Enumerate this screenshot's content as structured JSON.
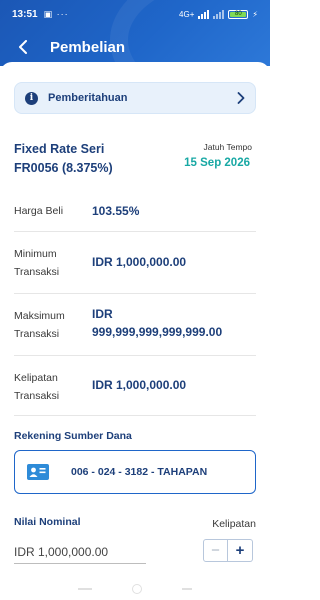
{
  "status_bar": {
    "time": "13:51",
    "left_icons": "▣ ···",
    "network": "4G+",
    "battery": "80"
  },
  "header": {
    "title": "Pembelian",
    "back_icon": "arrow-left-icon"
  },
  "notice": {
    "label": "Pemberitahuan",
    "icon": "info-icon",
    "chevron": "chevron-right-icon"
  },
  "bond": {
    "name_line1": "Fixed Rate Seri",
    "name_line2": "FR0056 (8.375%)",
    "due_label": "Jatuh Tempo",
    "due_date": "15 Sep 2026"
  },
  "details": [
    {
      "label_lines": [
        "Harga Beli"
      ],
      "value_lines": [
        "103.55%"
      ]
    },
    {
      "label_lines": [
        "Minimum",
        "Transaksi"
      ],
      "value_lines": [
        "IDR 1,000,000.00"
      ]
    },
    {
      "label_lines": [
        "Maksimum",
        "Transaksi"
      ],
      "value_lines": [
        "IDR",
        "999,999,999,999,999.00"
      ]
    },
    {
      "label_lines": [
        "Kelipatan",
        "Transaksi"
      ],
      "value_lines": [
        "IDR 1,000,000.00"
      ]
    }
  ],
  "source_account": {
    "title": "Rekening Sumber Dana",
    "account": "006 - 024 - 3182 - TAHAPAN",
    "icon": "id-card-icon"
  },
  "nominal": {
    "title": "Nilai Nominal",
    "kelipatan_label": "Kelipatan",
    "value": "IDR 1,000,000.00",
    "minus": "−",
    "plus": "+"
  },
  "colors": {
    "header_blue": "#1f66c9",
    "navy_text": "#1d3f7a",
    "teal_date": "#18a8a4",
    "notice_bg": "#e8f1fb"
  }
}
